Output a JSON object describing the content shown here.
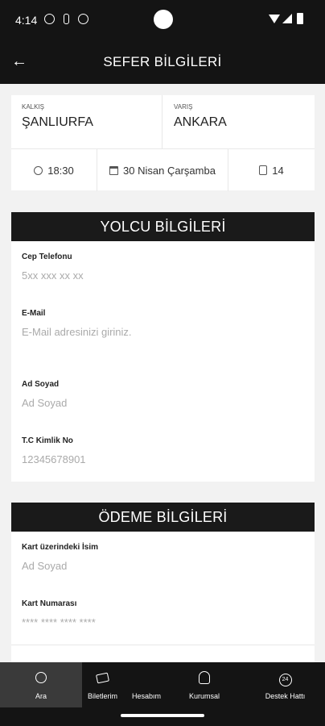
{
  "status_bar": {
    "time": "4:14"
  },
  "app_bar": {
    "back_icon": "arrow-left-icon",
    "title": "SEFER BİLGİLERİ"
  },
  "route": {
    "from_label": "KALKIŞ",
    "from_city": "ŞANLIURFA",
    "to_label": "VARIŞ",
    "to_city": "ANKARA",
    "time": "18:30",
    "date": "30 Nisan Çarşamba",
    "seat": "14"
  },
  "passenger": {
    "title": "YOLCU BİLGİLERİ",
    "phone_label": "Cep Telefonu",
    "phone_placeholder": "5xx xxx xx xx",
    "email_label": "E-Mail",
    "email_placeholder": "E-Mail adresinizi giriniz.",
    "name_label": "Ad Soyad",
    "name_placeholder": "Ad Soyad",
    "tc_label": "T.C Kimlik No",
    "tc_placeholder": "12345678901"
  },
  "payment": {
    "title": "ÖDEME BİLGİLERİ",
    "card_name_label": "Kart üzerindeki İsim",
    "card_name_placeholder": "Ad Soyad",
    "card_number_label": "Kart Numarası",
    "card_number_placeholder": "**** **** **** ****"
  },
  "bottom_nav": {
    "items": [
      {
        "label": "Ara",
        "icon": "search-icon",
        "active": true
      },
      {
        "label": "Biletlerim",
        "icon": "ticket-icon"
      },
      {
        "label": "Hesabım",
        "icon": ""
      },
      {
        "label": "Kurumsal",
        "icon": "person-icon"
      },
      {
        "label": "Destek Hattı",
        "icon": "headset-icon"
      }
    ]
  }
}
